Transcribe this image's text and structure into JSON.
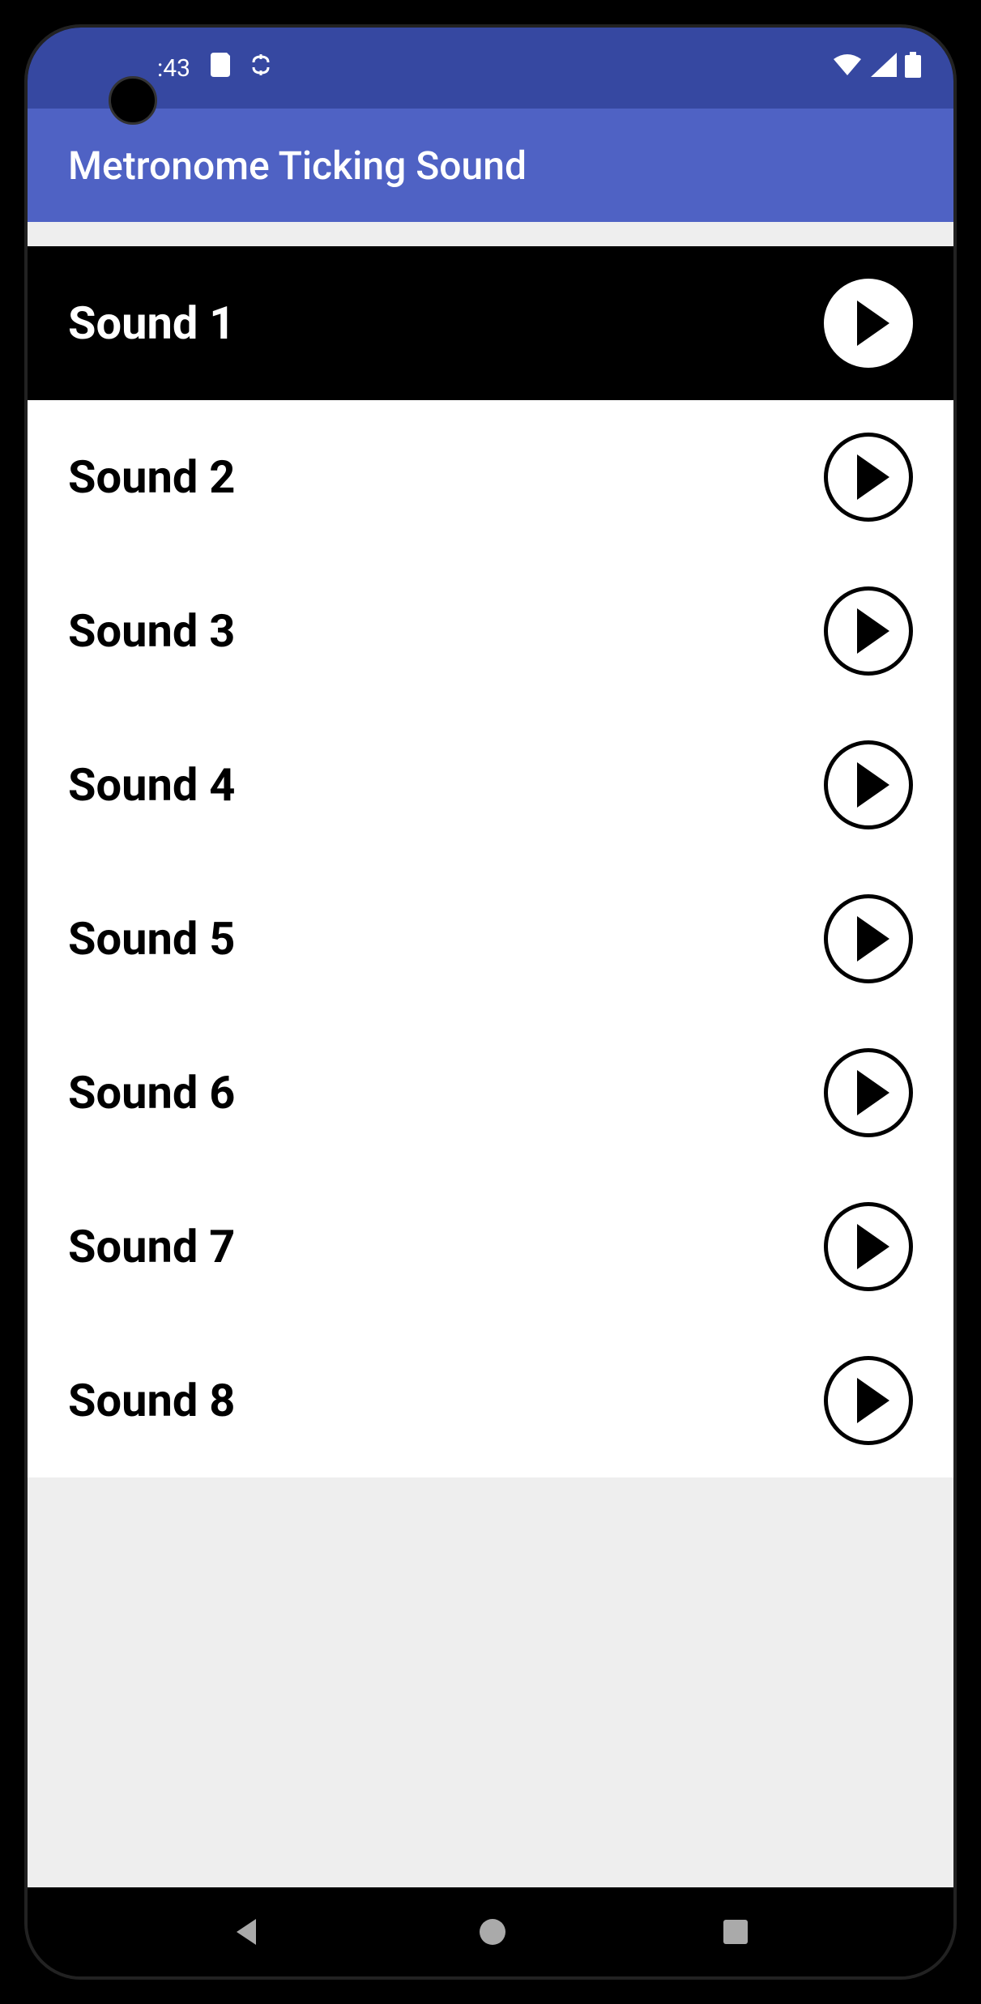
{
  "status_bar": {
    "time": ":43",
    "icons": {
      "sd_card": "sd-card-icon",
      "sync": "sync-icon",
      "wifi": "wifi-icon",
      "signal": "signal-icon",
      "battery": "battery-icon"
    }
  },
  "app_bar": {
    "title": "Metronome Ticking Sound"
  },
  "sounds": [
    {
      "label": "Sound 1",
      "selected": true
    },
    {
      "label": "Sound 2",
      "selected": false
    },
    {
      "label": "Sound 3",
      "selected": false
    },
    {
      "label": "Sound 4",
      "selected": false
    },
    {
      "label": "Sound 5",
      "selected": false
    },
    {
      "label": "Sound 6",
      "selected": false
    },
    {
      "label": "Sound 7",
      "selected": false
    },
    {
      "label": "Sound 8",
      "selected": false
    }
  ],
  "nav_bar": {
    "back": "back-icon",
    "home": "home-icon",
    "recent": "recent-icon"
  }
}
